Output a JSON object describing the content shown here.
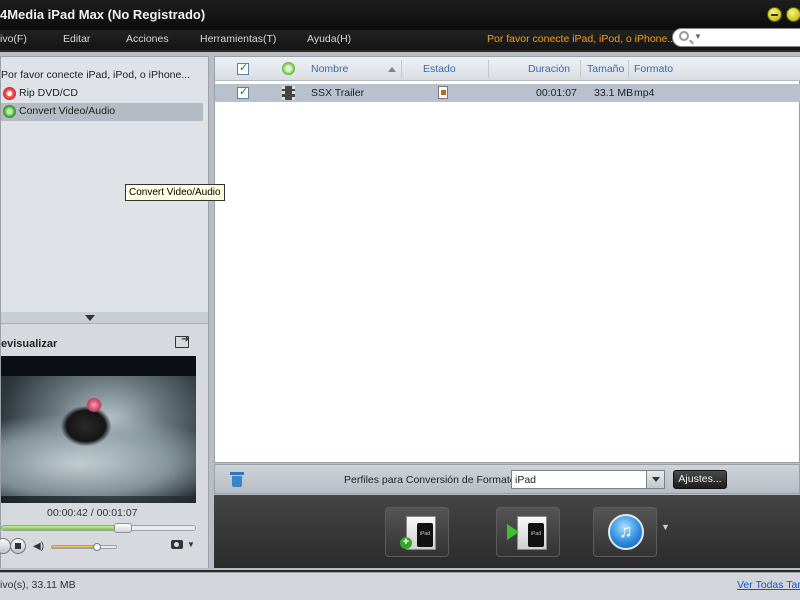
{
  "window": {
    "title": "4Media iPad Max (No Registrado)"
  },
  "menu": {
    "items": [
      "Archivo(F)",
      "Editar",
      "Acciones",
      "Herramientas(T)",
      "Ayuda(H)"
    ],
    "items_visible": [
      "ivo(F)",
      "Editar",
      "Acciones",
      "Herramientas(T)",
      "Ayuda(H)"
    ],
    "notice": "Por favor conecte iPad, iPod, o iPhone...",
    "notice_color": "#f0a01e"
  },
  "sidebar": {
    "items": [
      {
        "label": "Por favor conecte iPad, iPod, o iPhone...",
        "icon": "device-icon",
        "selected": false
      },
      {
        "label": "Rip DVD/CD",
        "icon": "rip-disc-icon",
        "selected": false
      },
      {
        "label": "Convert Video/Audio",
        "icon": "convert-icon",
        "selected": true
      }
    ],
    "tooltip": "Convert Video/Audio"
  },
  "preview": {
    "title": "evisualizar",
    "time": "00:00:42 / 00:01:07",
    "seek_fraction": 0.627,
    "volume_fraction": 0.7
  },
  "file_list": {
    "columns": [
      "Nombre",
      "Estado",
      "Duración",
      "Tamaño",
      "Formato"
    ],
    "rows": [
      {
        "checked": true,
        "name": "SSX Trailer",
        "duration": "00:01:07",
        "size": "33.1 MB",
        "format": "mp4"
      }
    ]
  },
  "profile": {
    "label": "Perfiles para Conversión de Formato:",
    "selected": "iPad",
    "settings_button": "Ajustes..."
  },
  "statusbar": {
    "left_text": "ivo(s), 33.11 MB",
    "link_text": "Ver Todas Tare"
  }
}
